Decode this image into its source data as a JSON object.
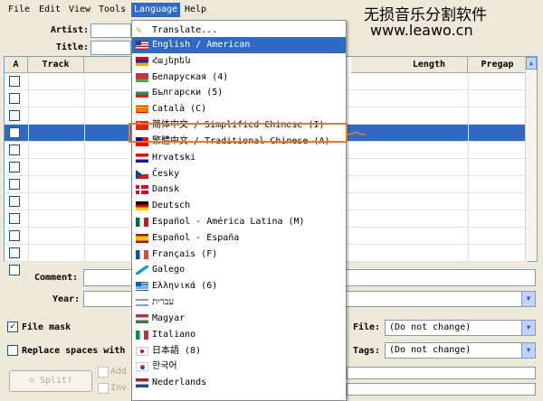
{
  "menubar": {
    "items": [
      "File",
      "Edit",
      "View",
      "Tools",
      "Language",
      "Help"
    ]
  },
  "watermark": {
    "line1": "无损音乐分割软件",
    "line2": "www.leawo.cn"
  },
  "header": {
    "artist_label": "Artist:",
    "title_label": "Title:"
  },
  "table": {
    "columns": [
      "A",
      "Track",
      "Length",
      "Pregap"
    ],
    "row_count": 12,
    "selected_row": 3
  },
  "lower": {
    "comment_label": "Comment:",
    "year_label": "Year:",
    "file_mask_label": "File mask",
    "replace_label": "Replace spaces with",
    "file_label": "File:",
    "file_value": "(Do not change)",
    "tags_label": "Tags:",
    "tags_value": "(Do not change)",
    "split_label": "Split!",
    "add_label": "Add",
    "inv_label": "Inv"
  },
  "language_menu": {
    "items": [
      {
        "label": "Translate...",
        "icon": "translate-icon"
      },
      {
        "label": "English / American",
        "icon": "flag-us",
        "selected": true
      },
      {
        "label": "Հայերեն",
        "icon": "flag-am"
      },
      {
        "label": "Беларуская (4)",
        "icon": "flag-by"
      },
      {
        "label": "Български (5)",
        "icon": "flag-bg"
      },
      {
        "label": "Català (C)",
        "icon": "flag-cat"
      },
      {
        "label": "简体中文 / Simplified Chinese (I)",
        "icon": "flag-cn",
        "highlighted": true
      },
      {
        "label": "繁體中文 / Traditional Chinese (A)",
        "icon": "flag-tw"
      },
      {
        "label": "Hrvatski",
        "icon": "flag-hr"
      },
      {
        "label": "Česky",
        "icon": "flag-cz"
      },
      {
        "label": "Dansk",
        "icon": "flag-dk"
      },
      {
        "label": "Deutsch",
        "icon": "flag-de"
      },
      {
        "label": "Español - América Latina (M)",
        "icon": "flag-mx"
      },
      {
        "label": "Español - España",
        "icon": "flag-es"
      },
      {
        "label": "Français (F)",
        "icon": "flag-fr"
      },
      {
        "label": "Galego",
        "icon": "flag-gl"
      },
      {
        "label": "Ελληνικά (6)",
        "icon": "flag-gr"
      },
      {
        "label": "עברית",
        "icon": "flag-il"
      },
      {
        "label": "Magyar",
        "icon": "flag-hu"
      },
      {
        "label": "Italiano",
        "icon": "flag-it"
      },
      {
        "label": "日本語 (8)",
        "icon": "flag-jp"
      },
      {
        "label": "한국어",
        "icon": "flag-kr"
      },
      {
        "label": "Nederlands",
        "icon": "flag-nl"
      }
    ]
  }
}
